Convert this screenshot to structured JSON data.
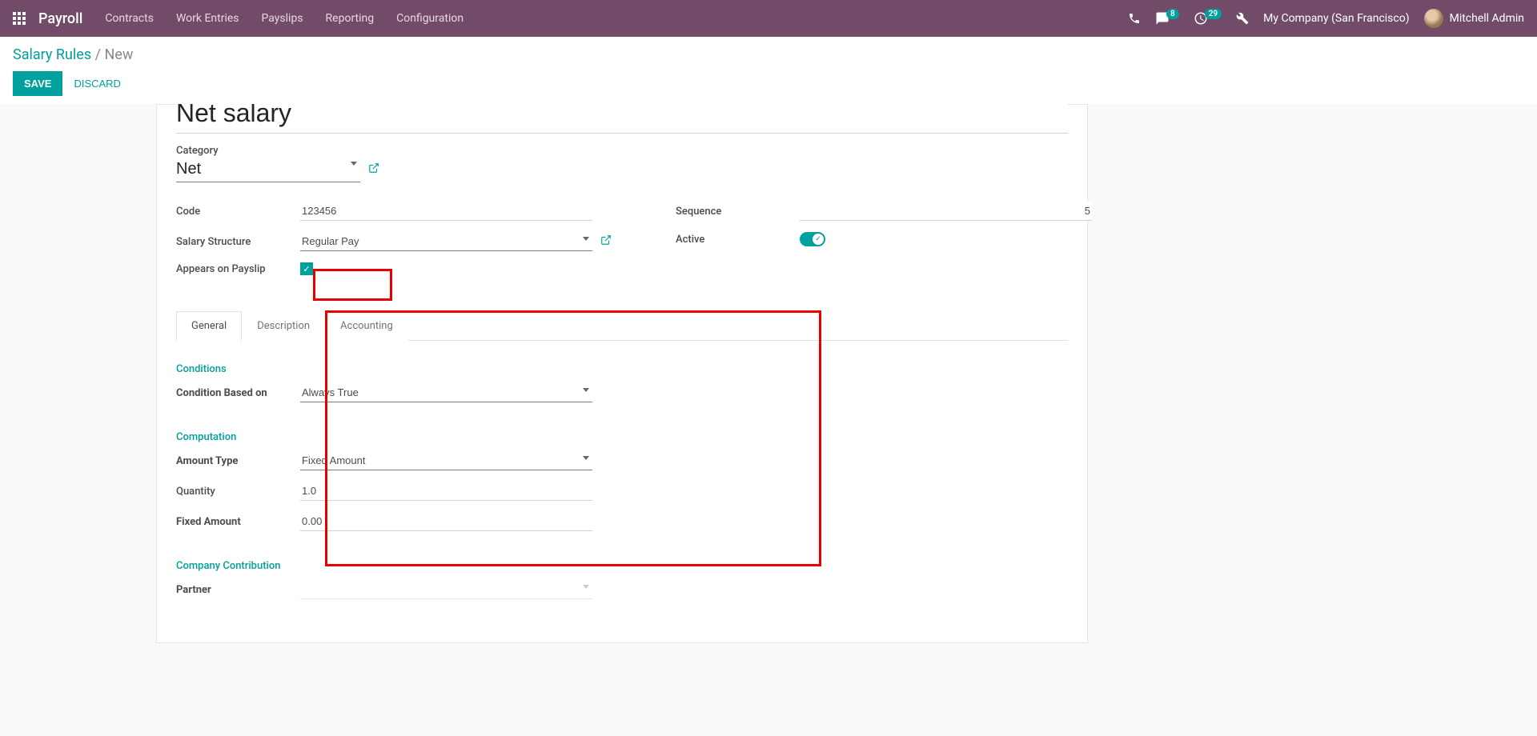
{
  "topbar": {
    "brand": "Payroll",
    "nav": [
      "Contracts",
      "Work Entries",
      "Payslips",
      "Reporting",
      "Configuration"
    ],
    "msg_badge": "8",
    "activity_badge": "29",
    "company": "My Company (San Francisco)",
    "user": "Mitchell Admin"
  },
  "breadcrumb": {
    "root": "Salary Rules",
    "sep": "/",
    "current": "New"
  },
  "actions": {
    "save": "SAVE",
    "discard": "DISCARD"
  },
  "form": {
    "title_value": "Net salary",
    "category_label": "Category",
    "category_value": "Net",
    "code_label": "Code",
    "code_value": "123456",
    "structure_label": "Salary Structure",
    "structure_value": "Regular Pay",
    "appears_label": "Appears on Payslip",
    "sequence_label": "Sequence",
    "sequence_value": "5",
    "active_label": "Active"
  },
  "tabs": {
    "general": "General",
    "description": "Description",
    "accounting": "Accounting"
  },
  "general": {
    "conditions_title": "Conditions",
    "cond_based_label": "Condition Based on",
    "cond_based_value": "Always True",
    "computation_title": "Computation",
    "amount_type_label": "Amount Type",
    "amount_type_value": "Fixed Amount",
    "quantity_label": "Quantity",
    "quantity_value": "1.0",
    "fixed_amount_label": "Fixed Amount",
    "fixed_amount_value": "0.00",
    "company_contrib_title": "Company Contribution",
    "partner_label": "Partner"
  }
}
